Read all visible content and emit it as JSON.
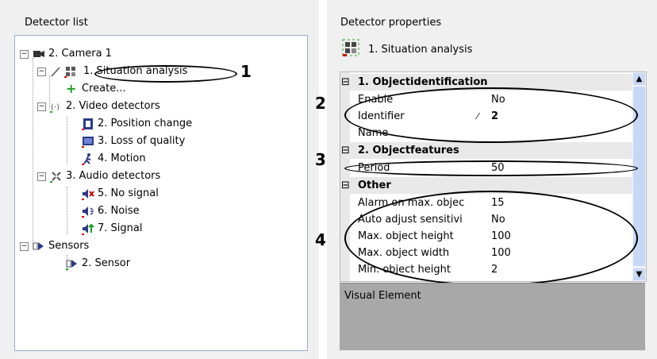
{
  "left_panel": {
    "title": "Detector list",
    "tree": {
      "camera": "2. Camera 1",
      "situation": "1. Situation analysis",
      "create": "Create...",
      "video_group": "2. Video detectors",
      "position_change": "2. Position change",
      "loss_quality": "3. Loss of quality",
      "motion": "4. Motion",
      "audio_group": "3. Audio detectors",
      "no_signal": "5. No signal",
      "noise": "6. Noise",
      "signal": "7. Signal",
      "sensors": "Sensors",
      "sensor": "2. Sensor"
    }
  },
  "right_panel": {
    "title": "Detector properties",
    "selected": "1. Situation analysis",
    "sections": {
      "s1": "1. Objectidentification",
      "s2": "2. Objectfeatures",
      "s3": "Other"
    },
    "props": {
      "enable": {
        "name": "Enable",
        "value": "No"
      },
      "identifier": {
        "name": "Identifier",
        "value": "2"
      },
      "name": {
        "name": "Name",
        "value": ""
      },
      "period": {
        "name": "Period",
        "value": "50"
      },
      "alarm": {
        "name": "Alarm on max. objec",
        "value": "15"
      },
      "autoadj": {
        "name": "Auto adjust sensitivi",
        "value": "No"
      },
      "maxh": {
        "name": "Max. object height",
        "value": "100"
      },
      "maxw": {
        "name": "Max. object width",
        "value": "100"
      },
      "minh": {
        "name": "Min. object height",
        "value": "2"
      }
    },
    "visual_element": "Visual Element"
  },
  "callouts": {
    "c1": "1",
    "c2": "2",
    "c3": "3",
    "c4": "4"
  },
  "colors": {
    "panel": "#f0f0f0",
    "tree_border": "#9aaec8",
    "section": "#e8e8e8",
    "visual": "#a8a8a8",
    "scroll": "#c8d8f4"
  }
}
